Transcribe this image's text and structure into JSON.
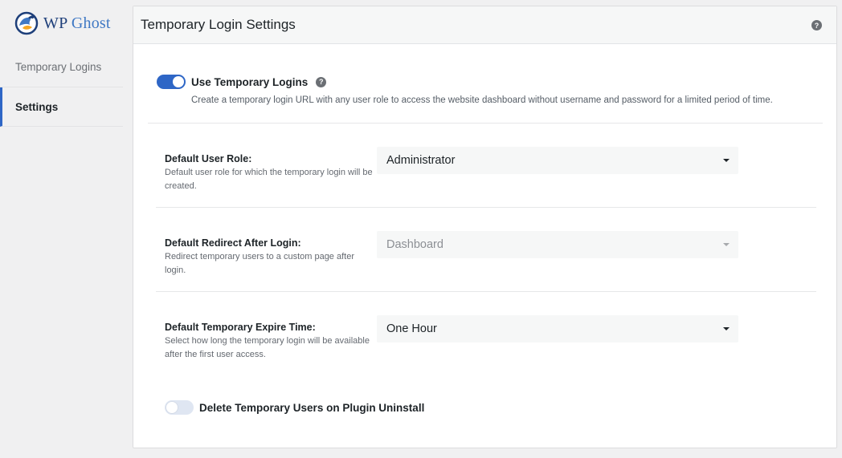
{
  "brand": {
    "name_wp": "WP",
    "name_ghost": "Ghost"
  },
  "sidebar": {
    "items": [
      {
        "label": "Temporary Logins",
        "active": false
      },
      {
        "label": "Settings",
        "active": true
      }
    ]
  },
  "header": {
    "title": "Temporary Login Settings",
    "help_icon": "question-circle-icon"
  },
  "use_temporary_logins": {
    "label": "Use Temporary Logins",
    "enabled": true,
    "description": "Create a temporary login URL with any user role to access the website dashboard without username and password for a limited period of time."
  },
  "settings": {
    "user_role": {
      "label": "Default User Role:",
      "help": "Default user role for which the temporary login will be created.",
      "value": "Administrator"
    },
    "redirect": {
      "label": "Default Redirect After Login:",
      "help": "Redirect temporary users to a custom page after login.",
      "value": "Dashboard",
      "disabled": true
    },
    "expire": {
      "label": "Default Temporary Expire Time:",
      "help": "Select how long the temporary login will be available after the first user access.",
      "value": "One Hour"
    }
  },
  "delete_on_uninstall": {
    "label": "Delete Temporary Users on Plugin Uninstall",
    "enabled": false
  },
  "colors": {
    "accent": "#2e66c6",
    "background": "#f0f0f1",
    "panel": "#ffffff"
  }
}
